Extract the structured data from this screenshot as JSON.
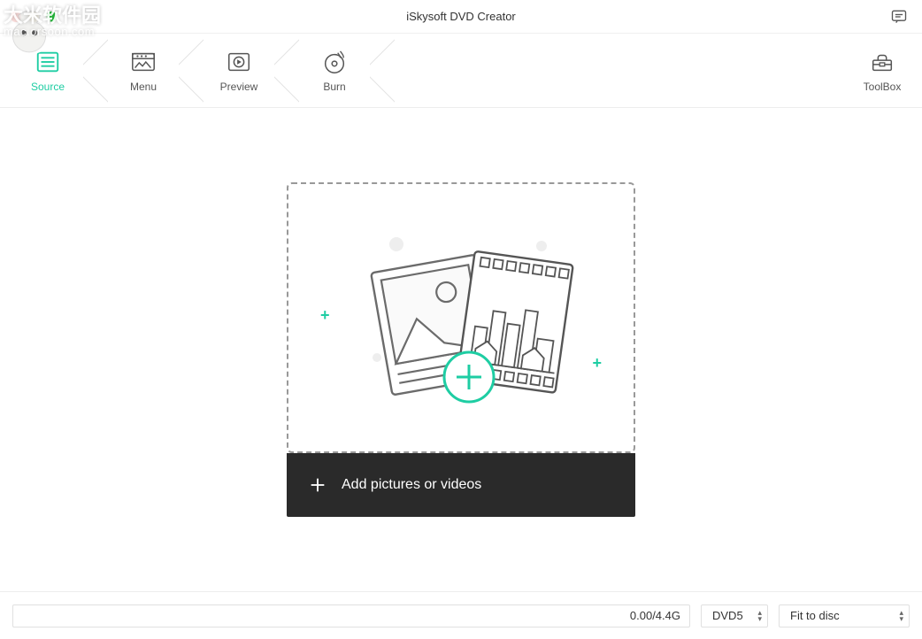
{
  "window": {
    "title": "iSkysoft DVD Creator"
  },
  "watermark": {
    "line1": "大米软件园",
    "line2": "mac.orsoon.com"
  },
  "nav": {
    "steps": [
      {
        "label": "Source",
        "active": true
      },
      {
        "label": "Menu",
        "active": false
      },
      {
        "label": "Preview",
        "active": false
      },
      {
        "label": "Burn",
        "active": false
      }
    ],
    "toolbox": "ToolBox"
  },
  "dropzone": {
    "add_label": "Add pictures or videos"
  },
  "footer": {
    "progress": "0.00/4.4G",
    "disc_type": "DVD5",
    "fit_mode": "Fit to disc"
  }
}
